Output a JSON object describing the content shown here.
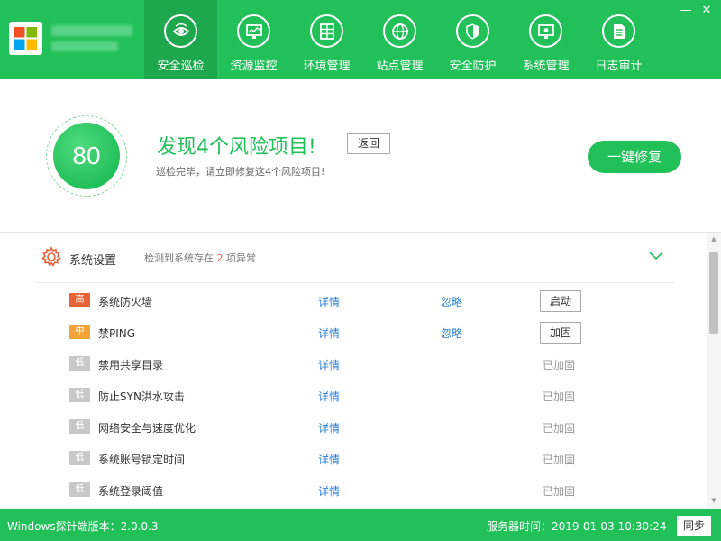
{
  "nav": [
    {
      "label": "安全巡检",
      "icon": "eye-scan-icon",
      "active": true
    },
    {
      "label": "资源监控",
      "icon": "monitor-chart-icon"
    },
    {
      "label": "环境管理",
      "icon": "server-rack-icon"
    },
    {
      "label": "站点管理",
      "icon": "globe-icon"
    },
    {
      "label": "安全防护",
      "icon": "shield-icon"
    },
    {
      "label": "系统管理",
      "icon": "gear-monitor-icon"
    },
    {
      "label": "日志审计",
      "icon": "document-icon"
    }
  ],
  "window": {
    "minimize": "—",
    "close": "✕"
  },
  "summary": {
    "score": "80",
    "title": "发现4个风险项目!",
    "subtitle": "巡检完毕，请立即修复这4个风险项目!",
    "back_label": "返回",
    "fix_label": "一键修复"
  },
  "section": {
    "title": "系统设置",
    "desc_prefix": "检测到系统存在",
    "count": "2",
    "desc_suffix": "项异常"
  },
  "items": [
    {
      "level": "高",
      "name": "系统防火墙",
      "detail": "详情",
      "ignore": "忽略",
      "action": "启动"
    },
    {
      "level": "中",
      "name": "禁PING",
      "detail": "详情",
      "ignore": "忽略",
      "action": "加固"
    },
    {
      "level": "低",
      "name": "禁用共享目录",
      "detail": "详情",
      "status": "已加固"
    },
    {
      "level": "低",
      "name": "防止SYN洪水攻击",
      "detail": "详情",
      "status": "已加固"
    },
    {
      "level": "低",
      "name": "网络安全与速度优化",
      "detail": "详情",
      "status": "已加固"
    },
    {
      "level": "低",
      "name": "系统账号锁定时间",
      "detail": "详情",
      "status": "已加固"
    },
    {
      "level": "低",
      "name": "系统登录阈值",
      "detail": "详情",
      "status": "已加固"
    }
  ],
  "scrollbar": {
    "up": "▲",
    "down": "▼"
  },
  "footer": {
    "version": "Windows探针端版本：2.0.0.3",
    "server_time": "服务器时间：2019-01-03 10:30:24",
    "sync_label": "同步"
  },
  "colors": {
    "brand": "#22c059",
    "high": "#ea6237",
    "mid": "#f4a43a",
    "low": "#c8c8c8",
    "link": "#2a7fd4"
  }
}
